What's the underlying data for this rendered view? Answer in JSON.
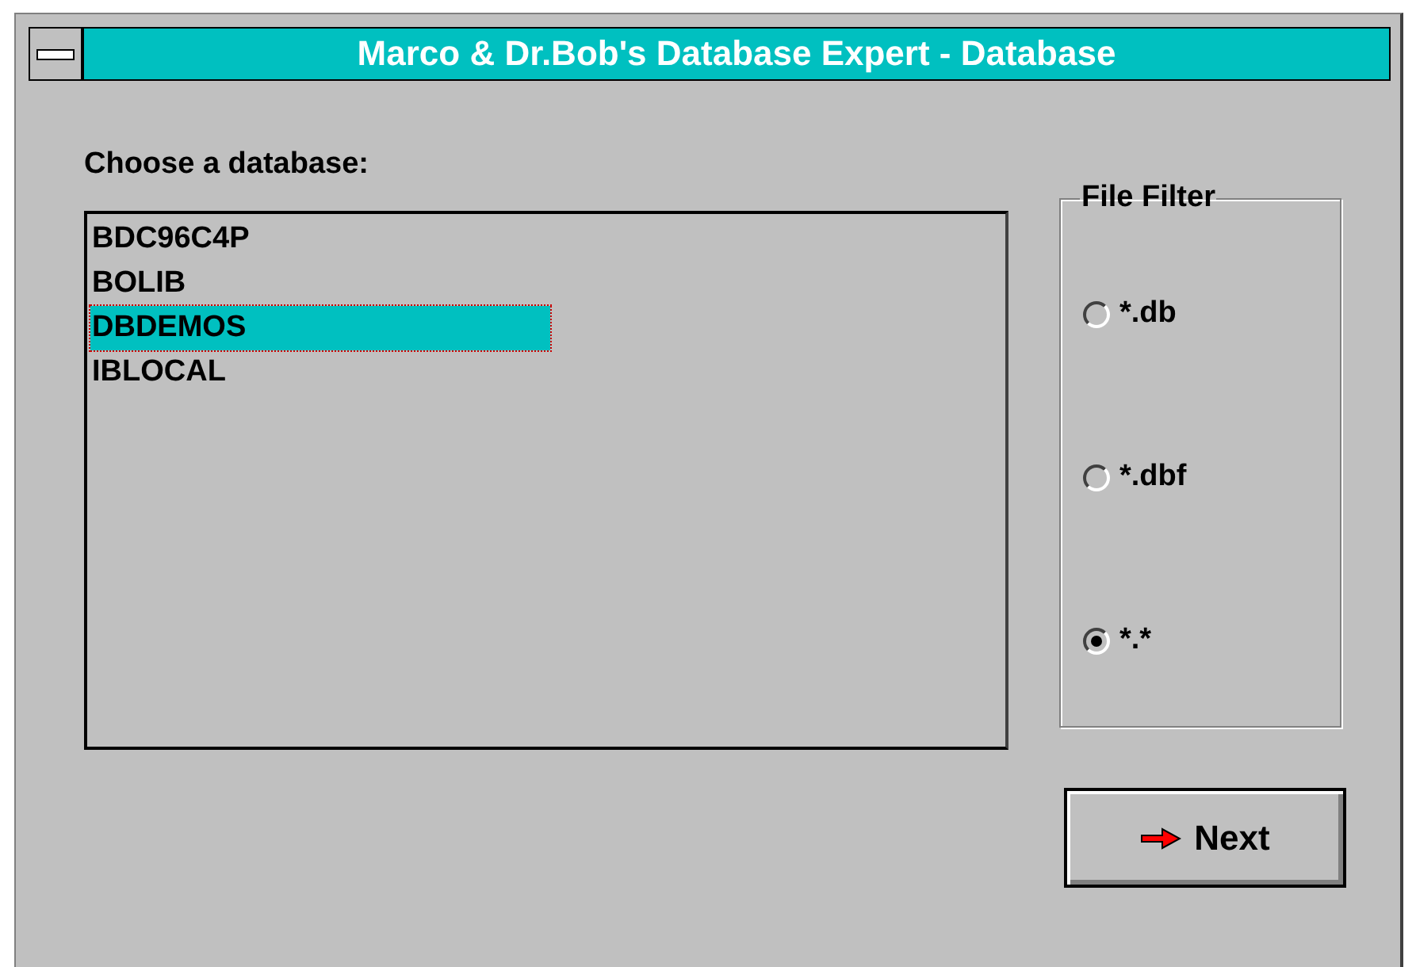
{
  "window": {
    "title": "Marco & Dr.Bob's Database Expert - Database"
  },
  "list": {
    "label": "Choose a database:",
    "items": [
      {
        "text": "BDC96C4P",
        "selected": false
      },
      {
        "text": "BOLIB",
        "selected": false
      },
      {
        "text": "DBDEMOS",
        "selected": true
      },
      {
        "text": "IBLOCAL",
        "selected": false
      }
    ]
  },
  "file_filter": {
    "title": "File Filter",
    "options": [
      {
        "label": "*.db",
        "selected": false
      },
      {
        "label": "*.dbf",
        "selected": false
      },
      {
        "label": "*.*",
        "selected": true
      }
    ]
  },
  "buttons": [
    {
      "label": "Next"
    }
  ]
}
